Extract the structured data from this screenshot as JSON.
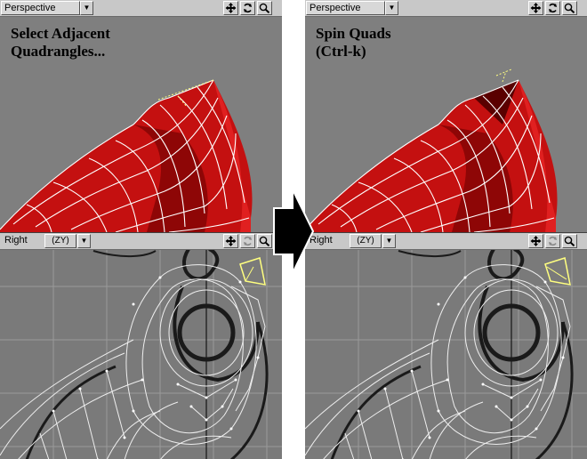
{
  "before": {
    "perspective_view": {
      "label": "Perspective",
      "caption": "Select Adjacent\nQuadrangles..."
    },
    "side_view": {
      "label": "Right",
      "axis": "(ZY)"
    }
  },
  "after": {
    "perspective_view": {
      "label": "Perspective",
      "caption": "Spin Quads\n(Ctrl-k)"
    },
    "side_view": {
      "label": "Right",
      "axis": "(ZY)"
    }
  },
  "icons": {
    "move": "move-icon",
    "rotate": "rotate-icon",
    "zoom": "zoom-icon",
    "dropdown": "chevron-down-icon",
    "transition": "right-arrow-icon"
  },
  "colors": {
    "mesh_red": "#c41010",
    "wire": "#ffffff",
    "selection": "#ffff80",
    "viewport_bg": "#7f7f7f",
    "toolbar_bg": "#c8c8c8"
  }
}
